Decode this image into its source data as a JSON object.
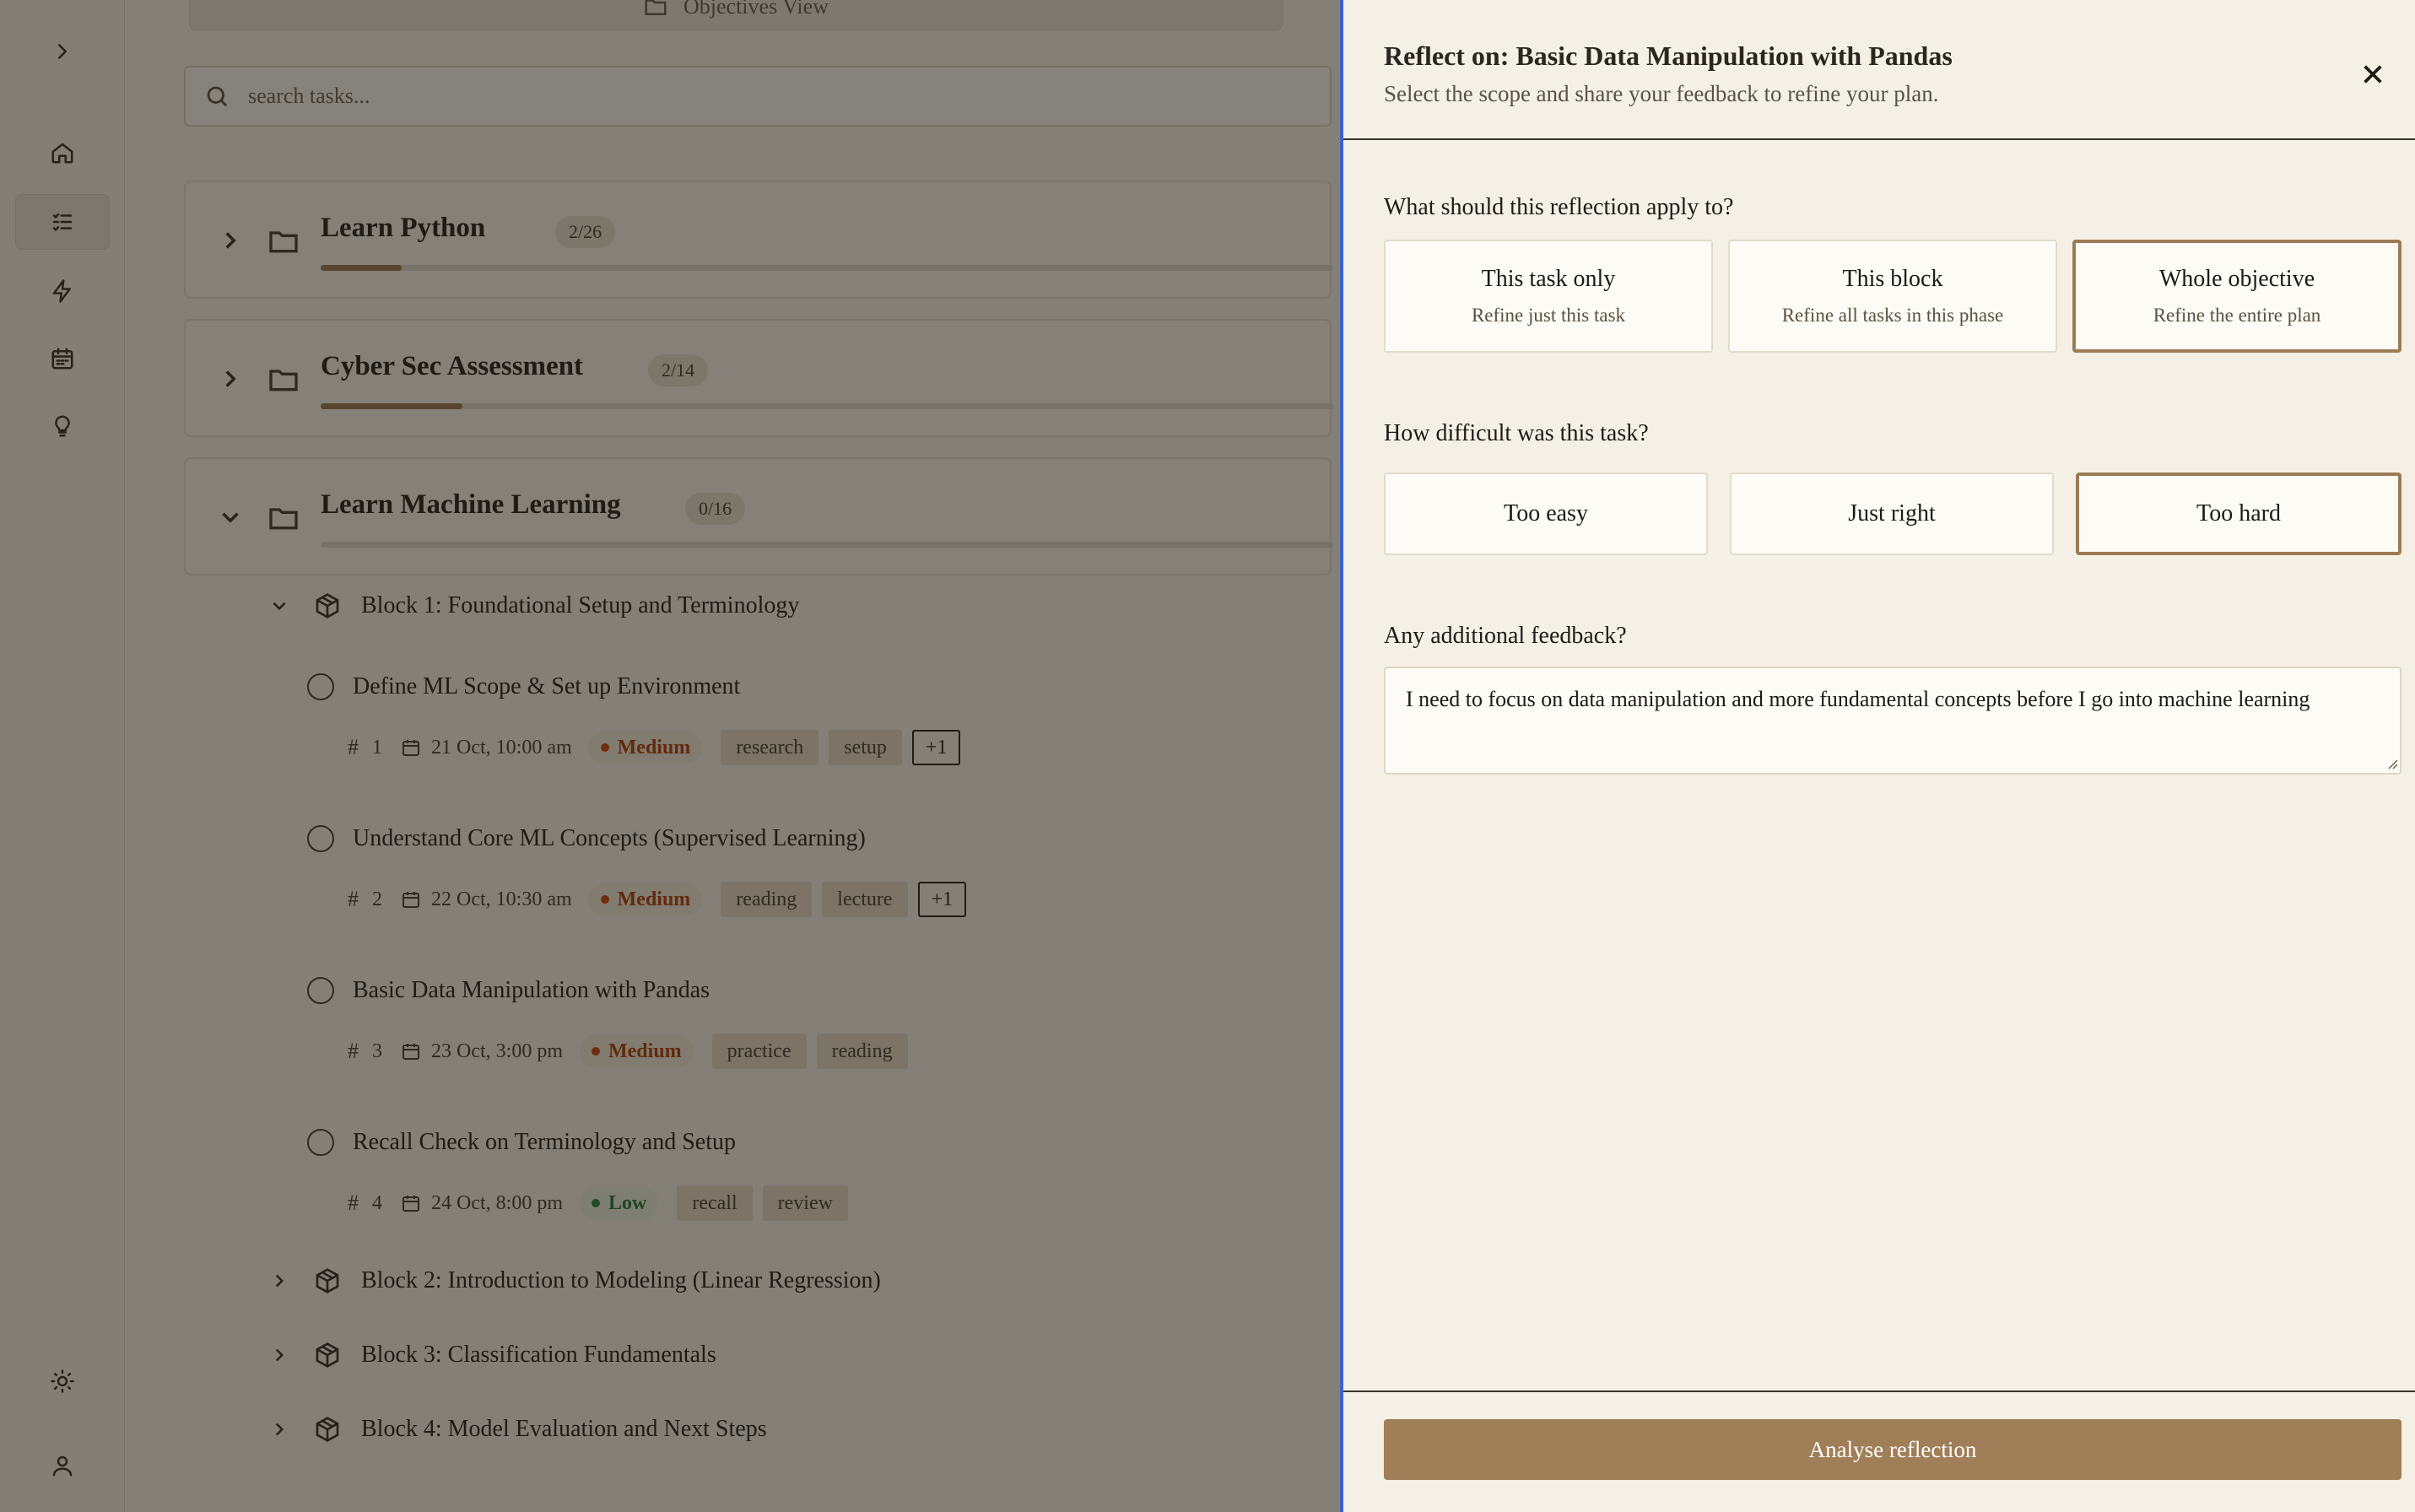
{
  "sidebar": {
    "icons": [
      "chevron-right-icon",
      "home-icon",
      "task-list-icon",
      "lightning-icon",
      "calendar-icon",
      "lightbulb-icon",
      "sun-icon",
      "user-icon"
    ]
  },
  "header": {
    "objectives_view_label": "Objectives View"
  },
  "search": {
    "placeholder": "search tasks..."
  },
  "objectives": [
    {
      "title": "Learn Python",
      "count": "2/26",
      "progress": 0.08
    },
    {
      "title": "Cyber Sec Assessment",
      "count": "2/14",
      "progress": 0.14
    },
    {
      "title": "Learn Machine Learning",
      "count": "0/16",
      "progress": 0.0
    }
  ],
  "blocks": [
    {
      "label": "Block 1: Foundational Setup and Terminology",
      "expanded": true
    },
    {
      "label": "Block 2: Introduction to Modeling (Linear Regression)",
      "expanded": false
    },
    {
      "label": "Block 3: Classification Fundamentals",
      "expanded": false
    },
    {
      "label": "Block 4: Model Evaluation and Next Steps",
      "expanded": false
    }
  ],
  "tasks": [
    {
      "title": "Define ML Scope & Set up Environment",
      "number": "1",
      "date": "21 Oct, 10:00 am",
      "priority": "Medium",
      "tags": [
        "research",
        "setup"
      ],
      "more": "+1"
    },
    {
      "title": "Understand Core ML Concepts (Supervised Learning)",
      "number": "2",
      "date": "22 Oct, 10:30 am",
      "priority": "Medium",
      "tags": [
        "reading",
        "lecture"
      ],
      "more": "+1"
    },
    {
      "title": "Basic Data Manipulation with Pandas",
      "number": "3",
      "date": "23 Oct, 3:00 pm",
      "priority": "Medium",
      "tags": [
        "practice",
        "reading"
      ]
    },
    {
      "title": "Recall Check on Terminology and Setup",
      "number": "4",
      "date": "24 Oct, 8:00 pm",
      "priority": "Low",
      "tags": [
        "recall",
        "review"
      ]
    }
  ],
  "task_hash_symbol": "#",
  "panel": {
    "title": "Reflect on: Basic Data Manipulation with Pandas",
    "subtitle": "Select the scope and share your feedback to refine your plan.",
    "scope_question": "What should this reflection apply to?",
    "scope_options": [
      {
        "label": "This task only",
        "sub": "Refine just this task",
        "selected": false
      },
      {
        "label": "This block",
        "sub": "Refine all tasks in this phase",
        "selected": false
      },
      {
        "label": "Whole objective",
        "sub": "Refine the entire plan",
        "selected": true
      }
    ],
    "difficulty_question": "How difficult was this task?",
    "difficulty_options": [
      {
        "label": "Too easy",
        "selected": false
      },
      {
        "label": "Just right",
        "selected": false
      },
      {
        "label": "Too hard",
        "selected": true
      }
    ],
    "feedback_question": "Any additional feedback?",
    "feedback_value": "I need to focus on data manipulation and more fundamental concepts before I go into machine learning",
    "submit_label": "Analyse reflection"
  },
  "colors": {
    "accent": "#a07e57",
    "panel_border": "#3b63c9",
    "priority_medium": "#b2440f",
    "priority_low": "#2f7a3b"
  }
}
